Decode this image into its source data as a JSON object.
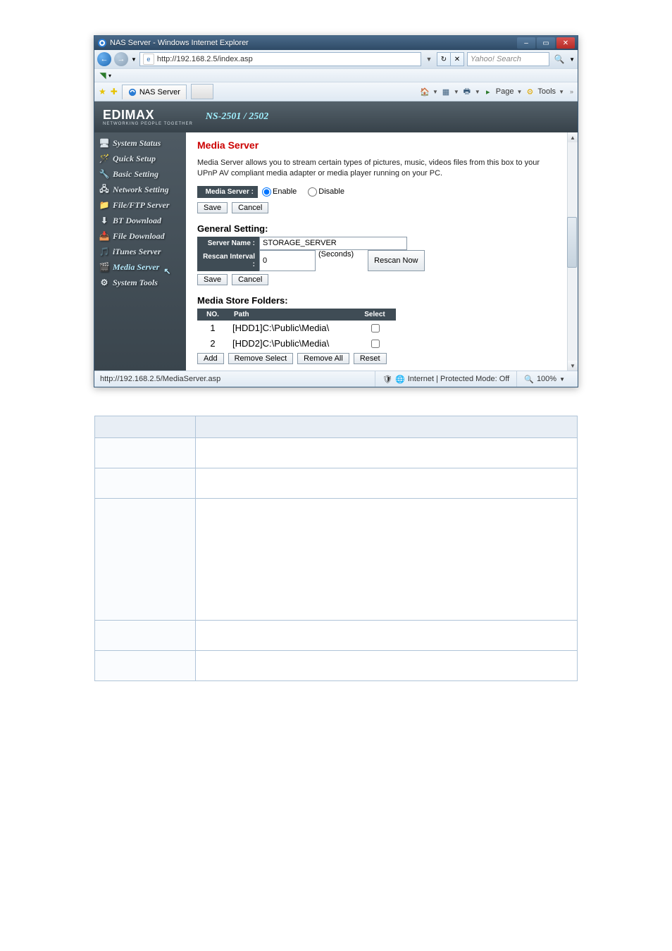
{
  "window": {
    "title": "NAS Server - Windows Internet Explorer"
  },
  "address_bar": {
    "url": "http://192.168.2.5/index.asp",
    "search_placeholder": "Yahoo! Search"
  },
  "tab": {
    "label": "NAS Server"
  },
  "command_bar": {
    "page": "Page",
    "tools": "Tools"
  },
  "brand": {
    "name": "EDIMAX",
    "tag": "NETWORKING PEOPLE TOGETHER",
    "model": "NS-2501 / 2502"
  },
  "sidebar": {
    "items": [
      "System Status",
      "Quick Setup",
      "Basic Setting",
      "Network Setting",
      "File/FTP Server",
      "BT Download",
      "File Download",
      "iTunes Server",
      "Media Server",
      "System Tools"
    ]
  },
  "content": {
    "title": "Media Server",
    "intro": "Media Server allows you to stream certain types of pictures, music, videos files from this box to your UPnP AV compliant media adapter or media player running on your PC.",
    "label_media_server": "Media Server :",
    "opt_enable": "Enable",
    "opt_disable": "Disable",
    "btn_save": "Save",
    "btn_cancel": "Cancel",
    "heading_general": "General Setting:",
    "label_server_name": "Server Name :",
    "val_server_name": "STORAGE_SERVER",
    "label_rescan": "Rescan Interval :",
    "val_rescan": "0",
    "unit_seconds": "(Seconds)",
    "btn_rescan_now": "Rescan Now",
    "heading_folders": "Media Store Folders:",
    "th_no": "NO.",
    "th_path": "Path",
    "th_select": "Select",
    "rows": [
      {
        "no": "1",
        "path": "[HDD1]C:\\Public\\Media\\"
      },
      {
        "no": "2",
        "path": "[HDD2]C:\\Public\\Media\\"
      }
    ],
    "btn_add": "Add",
    "btn_remove_select": "Remove Select",
    "btn_remove_all": "Remove All",
    "btn_reset": "Reset"
  },
  "status_bar": {
    "url": "http://192.168.2.5/MediaServer.asp",
    "zone": "Internet | Protected Mode: Off",
    "zoom": "100%"
  }
}
